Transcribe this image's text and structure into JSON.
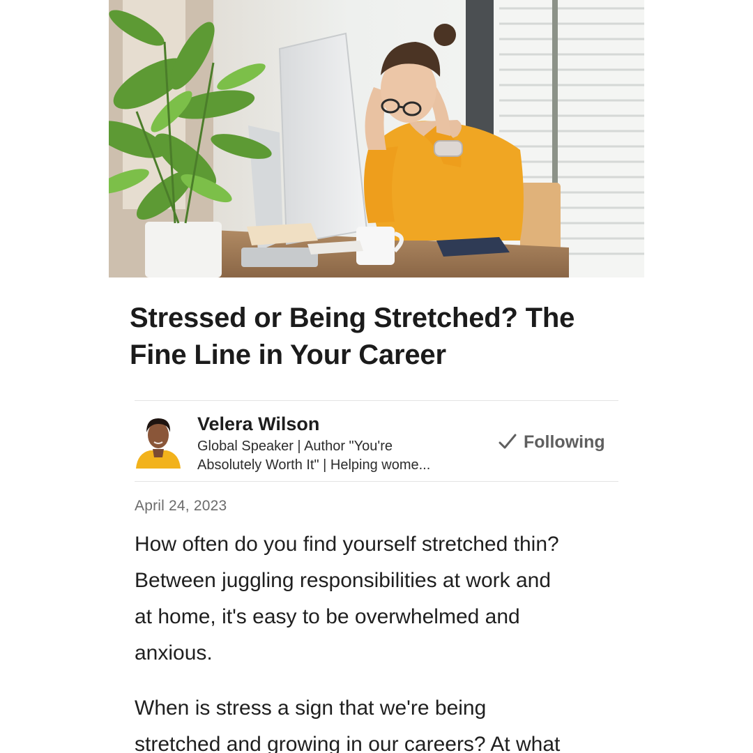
{
  "article": {
    "title_lines": [
      "Stressed or Being Stretched? The",
      "Fine Line in Your Career"
    ],
    "date": "April 24, 2023"
  },
  "author": {
    "name": "Velera Wilson",
    "headline_lines": [
      "Global Speaker | Author \"You're",
      "Absolutely Worth It\" | Helping wome..."
    ],
    "follow_label": "Following",
    "follow_icon": "check-icon"
  },
  "body": {
    "paragraph_1_lines": [
      "How often do you find yourself stretched thin?",
      "Between juggling responsibilities at work and",
      "at home, it's easy to be overwhelmed and",
      "anxious."
    ],
    "paragraph_2_lines": [
      "When is stress a sign that we're being",
      "stretched and growing in our careers? At what"
    ]
  },
  "colors": {
    "title": "#1b1b1b",
    "follow_text": "#5f5f5f",
    "date": "#6b6b6b",
    "divider": "#e3e3e3",
    "sweater": "#f0a623"
  }
}
